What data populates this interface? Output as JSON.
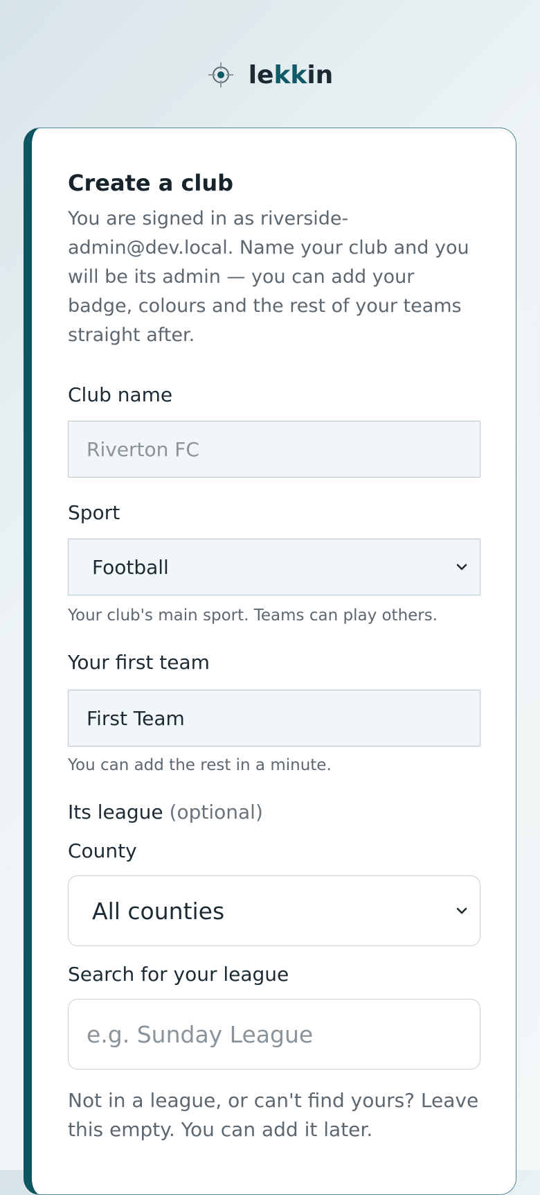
{
  "header": {
    "brand_prefix": "le",
    "brand_accent": "kk",
    "brand_suffix": "in",
    "logo_icon": "crosshair-icon"
  },
  "form": {
    "title": "Create a club",
    "intro": "You are signed in as riverside-admin@dev.local. Name your club and you will be its admin — you can add your badge, colours and the rest of your teams straight after.",
    "club_name": {
      "label": "Club name",
      "placeholder": "Riverton FC",
      "value": ""
    },
    "sport": {
      "label": "Sport",
      "selected": "Football",
      "hint": "Your club's main sport. Teams can play others."
    },
    "first_team": {
      "label": "Your first team",
      "value": "First Team",
      "hint": "You can add the rest in a minute."
    },
    "league": {
      "label": "Its league",
      "optional": "(optional)"
    },
    "county": {
      "label": "County",
      "selected": "All counties"
    },
    "league_search": {
      "label": "Search for your league",
      "placeholder": "e.g. Sunday League",
      "value": ""
    },
    "bottom_note": "Not in a league, or can't find yours? Leave this empty. You can add it later."
  },
  "colors": {
    "accent": "#0d5560",
    "text": "#1c2a33",
    "muted": "#5d6770",
    "field_bg": "#f1f6f8"
  }
}
